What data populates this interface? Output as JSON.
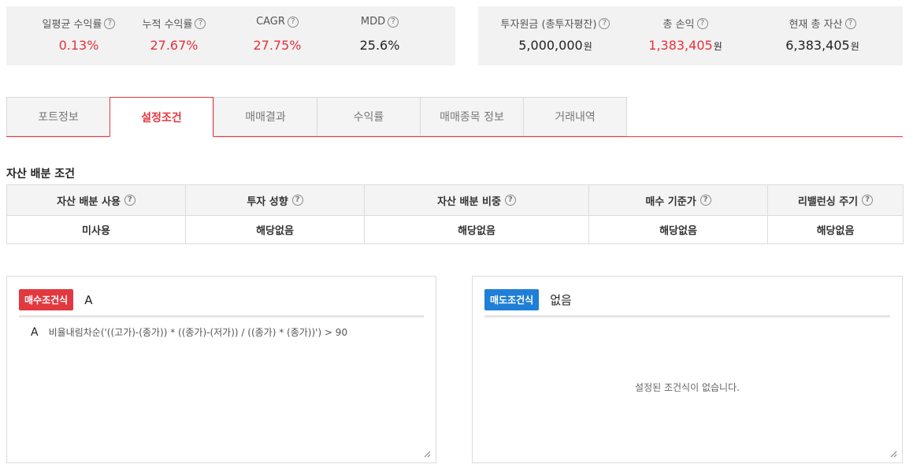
{
  "stats_left": [
    {
      "label": "일평균 수익률",
      "value": "0.13%",
      "color": "red"
    },
    {
      "label": "누적 수익률",
      "value": "27.67%",
      "color": "red"
    },
    {
      "label": "CAGR",
      "value": "27.75%",
      "color": "red"
    },
    {
      "label": "MDD",
      "value": "25.6%",
      "color": "default"
    }
  ],
  "stats_right": [
    {
      "label": "투자원금 (총투자평잔)",
      "value": "5,000,000",
      "unit": "원",
      "color": "default"
    },
    {
      "label": "총 손익",
      "value": "1,383,405",
      "unit": "원",
      "color": "red"
    },
    {
      "label": "현재 총 자산",
      "value": "6,383,405",
      "unit": "원",
      "color": "default"
    }
  ],
  "help_glyph": "?",
  "tabs": [
    "포트정보",
    "설정조건",
    "매매결과",
    "수익률",
    "매매종목 정보",
    "거래내역"
  ],
  "active_tab": "설정조건",
  "allocation": {
    "title": "자산 배분 조건",
    "headers": [
      "자산 배분 사용",
      "투자 성향",
      "자산 배분 비중",
      "매수 기준가",
      "리밸런싱 주기"
    ],
    "values": [
      "미사용",
      "해당없음",
      "해당없음",
      "해당없음",
      "해당없음"
    ]
  },
  "buy_panel": {
    "badge": "매수조건식",
    "expression": "A",
    "conditions": [
      {
        "key": "A",
        "formula": "비율내림차순('((고가)-(종가)) * ((종가)-(저가)) / ((종가) * (종가))') > 90"
      }
    ]
  },
  "sell_panel": {
    "badge": "매도조건식",
    "expression": "없음",
    "empty_message": "설정된 조건식이 없습니다."
  },
  "colors": {
    "accent_red": "#e2383f",
    "accent_blue": "#1f7fd6",
    "value_red": "#e8303a"
  }
}
